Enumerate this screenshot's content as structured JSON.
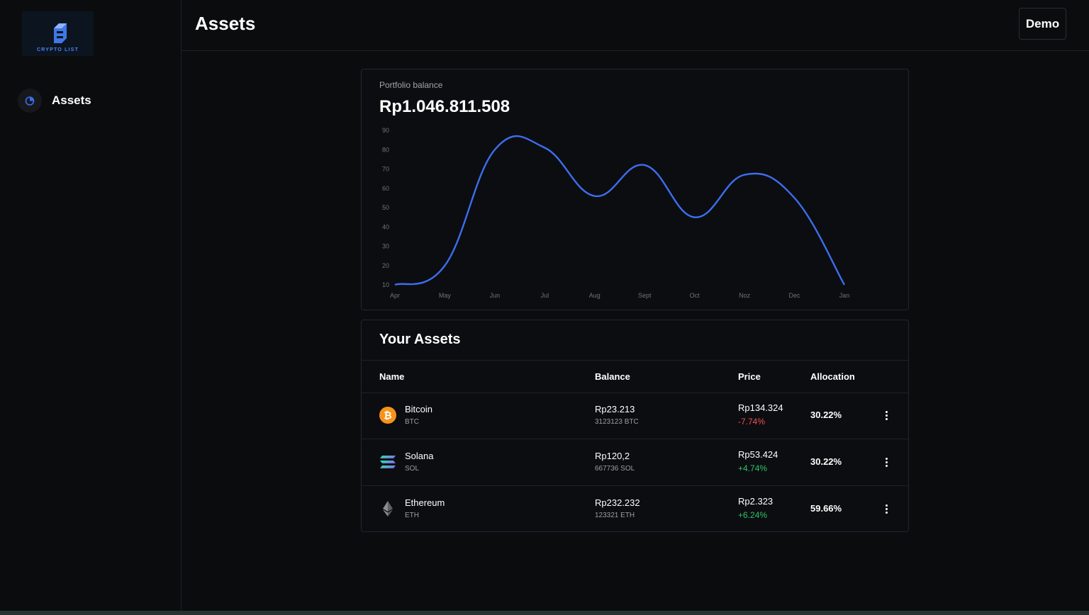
{
  "sidebar": {
    "logo_text": "CRYPTO LIST",
    "items": [
      {
        "label": "Assets",
        "icon": "pie-chart-icon",
        "active": true
      }
    ]
  },
  "header": {
    "title": "Assets",
    "user_button": "Demo"
  },
  "portfolio": {
    "label": "Portfolio balance",
    "value": "Rp1.046.811.508",
    "line_color": "#3b6ef0"
  },
  "chart_data": {
    "type": "line",
    "categories": [
      "Apr",
      "May",
      "Jun",
      "Jul",
      "Aug",
      "Sept",
      "Oct",
      "Noz",
      "Dec",
      "Jan"
    ],
    "series": [
      {
        "values": [
          10,
          20,
          80,
          81,
          56,
          72,
          45,
          67,
          55,
          10
        ]
      }
    ],
    "yticks": [
      10,
      20,
      30,
      40,
      50,
      60,
      70,
      80,
      90
    ],
    "ylim": [
      10,
      90
    ],
    "grid": false,
    "title": "",
    "xlabel": "",
    "ylabel": ""
  },
  "assets": {
    "title": "Your Assets",
    "columns": [
      "Name",
      "Balance",
      "Price",
      "Allocation"
    ],
    "rows": [
      {
        "name": "Bitcoin",
        "symbol": "BTC",
        "icon": "bitcoin-icon",
        "balance": "Rp23.213",
        "balance_sub": "3123123 BTC",
        "price": "Rp134.324",
        "change": "-7.74%",
        "trend": "down",
        "allocation": "30.22%"
      },
      {
        "name": "Solana",
        "symbol": "SOL",
        "icon": "solana-icon",
        "balance": "Rp120,2",
        "balance_sub": "667736 SOL",
        "price": "Rp53.424",
        "change": "+4.74%",
        "trend": "up",
        "allocation": "30.22%"
      },
      {
        "name": "Ethereum",
        "symbol": "ETH",
        "icon": "ethereum-icon",
        "balance": "Rp232.232",
        "balance_sub": "123321 ETH",
        "price": "Rp2.323",
        "change": "+6.24%",
        "trend": "up",
        "allocation": "59.66%"
      }
    ]
  }
}
